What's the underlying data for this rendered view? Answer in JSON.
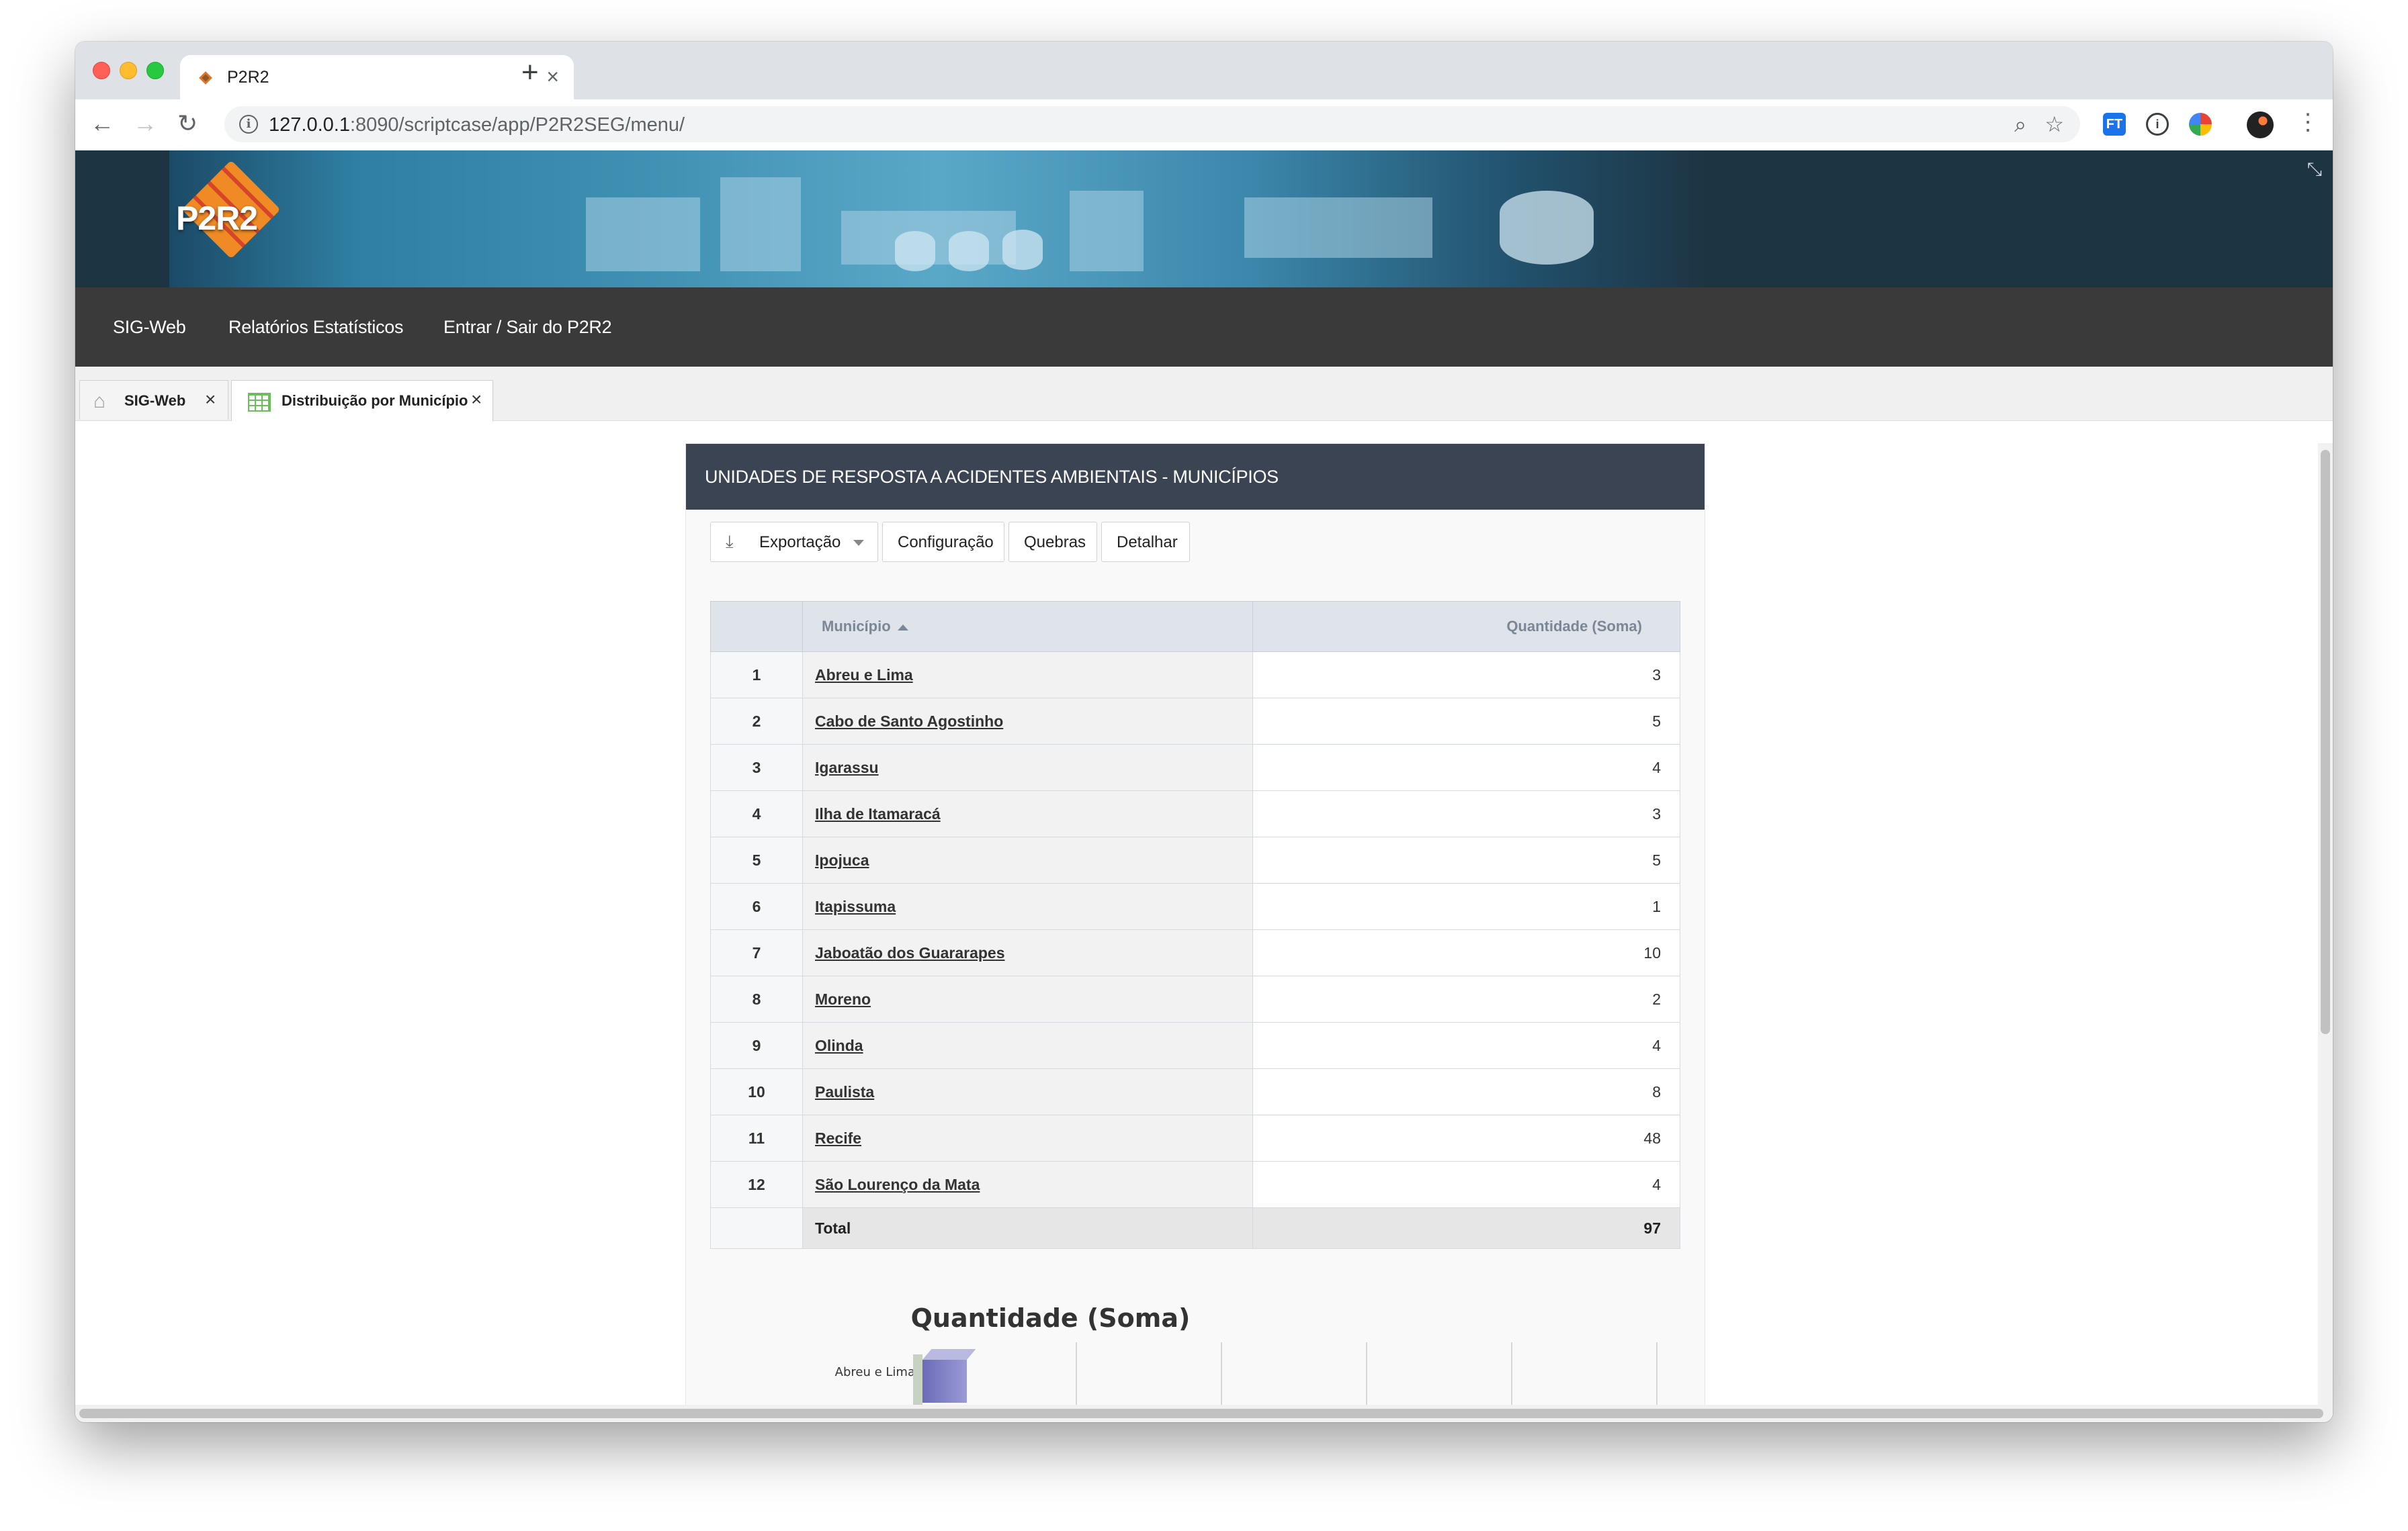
{
  "browser": {
    "tab_title": "P2R2",
    "url_host": "127.0.0.1",
    "url_rest": ":8090/scriptcase/app/P2R2SEG/menu/",
    "ext_1_label": "FT",
    "ext_2_label": "i"
  },
  "app": {
    "logo_text": "P2R2",
    "menu": [
      "SIG-Web",
      "Relatórios Estatísticos",
      "Entrar / Sair do P2R2"
    ],
    "tabs": [
      {
        "label": "SIG-Web"
      },
      {
        "label": "Distribuição por Município"
      }
    ]
  },
  "report": {
    "title": "UNIDADES DE RESPOSTA A ACIDENTES AMBIENTAIS - MUNICÍPIOS",
    "buttons": {
      "export": "Exportação",
      "config": "Configuração",
      "breaks": "Quebras",
      "detail": "Detalhar"
    },
    "table": {
      "col_municipio": "Município",
      "col_quantidade": "Quantidade (Soma)",
      "rows": [
        {
          "n": "1",
          "municipio": "Abreu e Lima",
          "qtd": "3"
        },
        {
          "n": "2",
          "municipio": "Cabo de Santo Agostinho",
          "qtd": "5"
        },
        {
          "n": "3",
          "municipio": "Igarassu",
          "qtd": "4"
        },
        {
          "n": "4",
          "municipio": "Ilha de Itamaracá",
          "qtd": "3"
        },
        {
          "n": "5",
          "municipio": "Ipojuca",
          "qtd": "5"
        },
        {
          "n": "6",
          "municipio": "Itapissuma",
          "qtd": "1"
        },
        {
          "n": "7",
          "municipio": "Jaboatão dos Guararapes",
          "qtd": "10"
        },
        {
          "n": "8",
          "municipio": "Moreno",
          "qtd": "2"
        },
        {
          "n": "9",
          "municipio": "Olinda",
          "qtd": "4"
        },
        {
          "n": "10",
          "municipio": "Paulista",
          "qtd": "8"
        },
        {
          "n": "11",
          "municipio": "Recife",
          "qtd": "48"
        },
        {
          "n": "12",
          "municipio": "São Lourenço da Mata",
          "qtd": "4"
        }
      ],
      "total_label": "Total",
      "total_value": "97"
    }
  },
  "chart_data": {
    "type": "bar",
    "title": "Quantidade (Soma)",
    "categories": [
      "Abreu e Lima"
    ],
    "values": [
      3
    ],
    "xlim": [
      0,
      50
    ],
    "bar_color": "#6b6bb8"
  }
}
